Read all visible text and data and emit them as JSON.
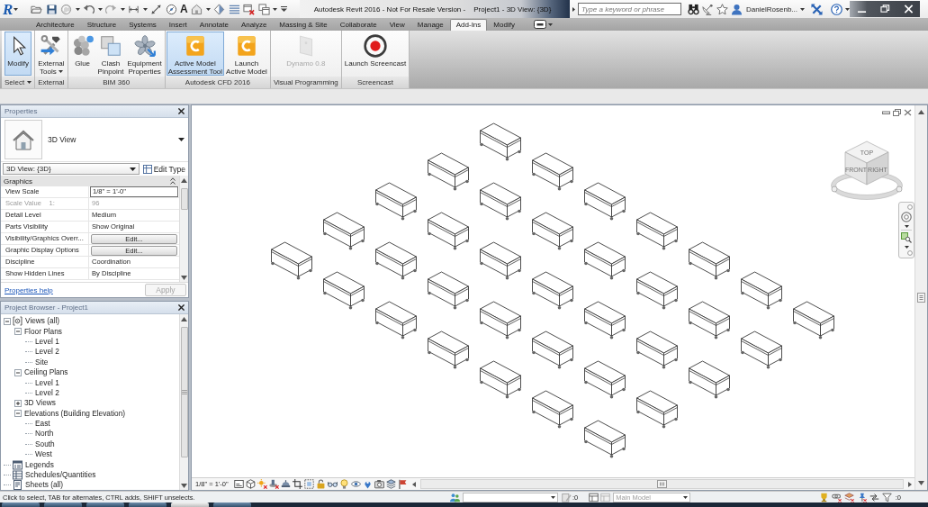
{
  "title_bar": {
    "app_glyph": "R",
    "text_glyph": "A",
    "app_title": "Autodesk Revit 2016 - Not For Resale Version -",
    "document_title": "Project1 - 3D View: {3D}",
    "search": {
      "placeholder": "Type a keyword or phrase"
    },
    "user": "DanielRosenb..."
  },
  "ribbon": {
    "tabs": [
      {
        "label": "Architecture",
        "selected": false
      },
      {
        "label": "Structure",
        "selected": false
      },
      {
        "label": "Systems",
        "selected": false
      },
      {
        "label": "Insert",
        "selected": false
      },
      {
        "label": "Annotate",
        "selected": false
      },
      {
        "label": "Analyze",
        "selected": false
      },
      {
        "label": "Massing & Site",
        "selected": false
      },
      {
        "label": "Collaborate",
        "selected": false
      },
      {
        "label": "View",
        "selected": false
      },
      {
        "label": "Manage",
        "selected": false
      },
      {
        "label": "Add-Ins",
        "selected": true
      },
      {
        "label": "Modify",
        "selected": false
      }
    ],
    "panels": [
      {
        "title": "Select",
        "menu": true,
        "buttons": [
          {
            "label": "Modify",
            "selected": true,
            "disabled": false,
            "dropdown": false
          }
        ]
      },
      {
        "title": "External",
        "menu": false,
        "buttons": [
          {
            "label": "External\nTools",
            "selected": false,
            "disabled": false,
            "dropdown": true
          }
        ]
      },
      {
        "title": "BIM 360",
        "menu": false,
        "buttons": [
          {
            "label": "Glue",
            "selected": false,
            "disabled": false,
            "dropdown": false
          },
          {
            "label": "Clash\nPinpoint",
            "selected": false,
            "disabled": false,
            "dropdown": false
          },
          {
            "label": "Equipment\nProperties",
            "selected": false,
            "disabled": false,
            "dropdown": false
          }
        ]
      },
      {
        "title": "Autodesk CFD 2016",
        "menu": false,
        "buttons": [
          {
            "label": "Active Model\nAssessment Tool",
            "selected": true,
            "disabled": false,
            "dropdown": false
          },
          {
            "label": "Launch\nActive Model",
            "selected": false,
            "disabled": false,
            "dropdown": false
          }
        ]
      },
      {
        "title": "Visual Programming",
        "menu": false,
        "buttons": [
          {
            "label": "Dynamo 0.8",
            "selected": false,
            "disabled": true,
            "dropdown": false
          }
        ]
      },
      {
        "title": "Screencast",
        "menu": false,
        "buttons": [
          {
            "label": "Launch Screencast",
            "selected": false,
            "disabled": false,
            "dropdown": false
          }
        ]
      }
    ]
  },
  "properties": {
    "title": "Properties",
    "type_name": "3D View",
    "instance": "3D View: {3D}",
    "edit_type": "Edit Type",
    "group": "Graphics",
    "rows": [
      {
        "name": "View Scale",
        "value": "1/8\" = 1'-0\"",
        "kind": "field",
        "disabled": false
      },
      {
        "name": "Scale Value    1:",
        "value": "96",
        "kind": "text",
        "disabled": true
      },
      {
        "name": "Detail Level",
        "value": "Medium",
        "kind": "text",
        "disabled": false
      },
      {
        "name": "Parts Visibility",
        "value": "Show Original",
        "kind": "text",
        "disabled": false
      },
      {
        "name": "Visibility/Graphics Overr...",
        "value": "Edit...",
        "kind": "button",
        "disabled": false
      },
      {
        "name": "Graphic Display Options",
        "value": "Edit...",
        "kind": "button",
        "disabled": false
      },
      {
        "name": "Discipline",
        "value": "Coordination",
        "kind": "text",
        "disabled": false
      },
      {
        "name": "Show Hidden Lines",
        "value": "By Discipline",
        "kind": "text",
        "disabled": false
      }
    ],
    "help": "Properties help",
    "apply": {
      "label": "Apply",
      "disabled": true
    }
  },
  "project_browser": {
    "title": "Project Browser - Project1",
    "tree": [
      {
        "label": "Views (all)",
        "kind": "views",
        "expanded": true,
        "children": [
          {
            "label": "Floor Plans",
            "expanded": true,
            "children": [
              {
                "label": "Level 1"
              },
              {
                "label": "Level 2"
              },
              {
                "label": "Site"
              }
            ]
          },
          {
            "label": "Ceiling Plans",
            "expanded": true,
            "children": [
              {
                "label": "Level 1"
              },
              {
                "label": "Level 2"
              }
            ]
          },
          {
            "label": "3D Views",
            "expanded": false
          },
          {
            "label": "Elevations (Building Elevation)",
            "expanded": true,
            "children": [
              {
                "label": "East"
              },
              {
                "label": "North"
              },
              {
                "label": "South"
              },
              {
                "label": "West"
              }
            ]
          }
        ]
      },
      {
        "label": "Legends",
        "kind": "legends"
      },
      {
        "label": "Schedules/Quantities",
        "kind": "schedules"
      },
      {
        "label": "Sheets (all)",
        "kind": "sheets"
      }
    ]
  },
  "view": {
    "scale": "1/8\" = 1'-0\"",
    "cube": {
      "top": "TOP",
      "front": "FRONT",
      "right": "RIGHT"
    }
  },
  "status_bar": {
    "message": "Click to select, TAB for alternates, CTRL adds, SHIFT unselects.",
    "editable_count": ":0",
    "design_option": {
      "value": "Main Model",
      "disabled": true
    },
    "filter_count": ":0"
  }
}
